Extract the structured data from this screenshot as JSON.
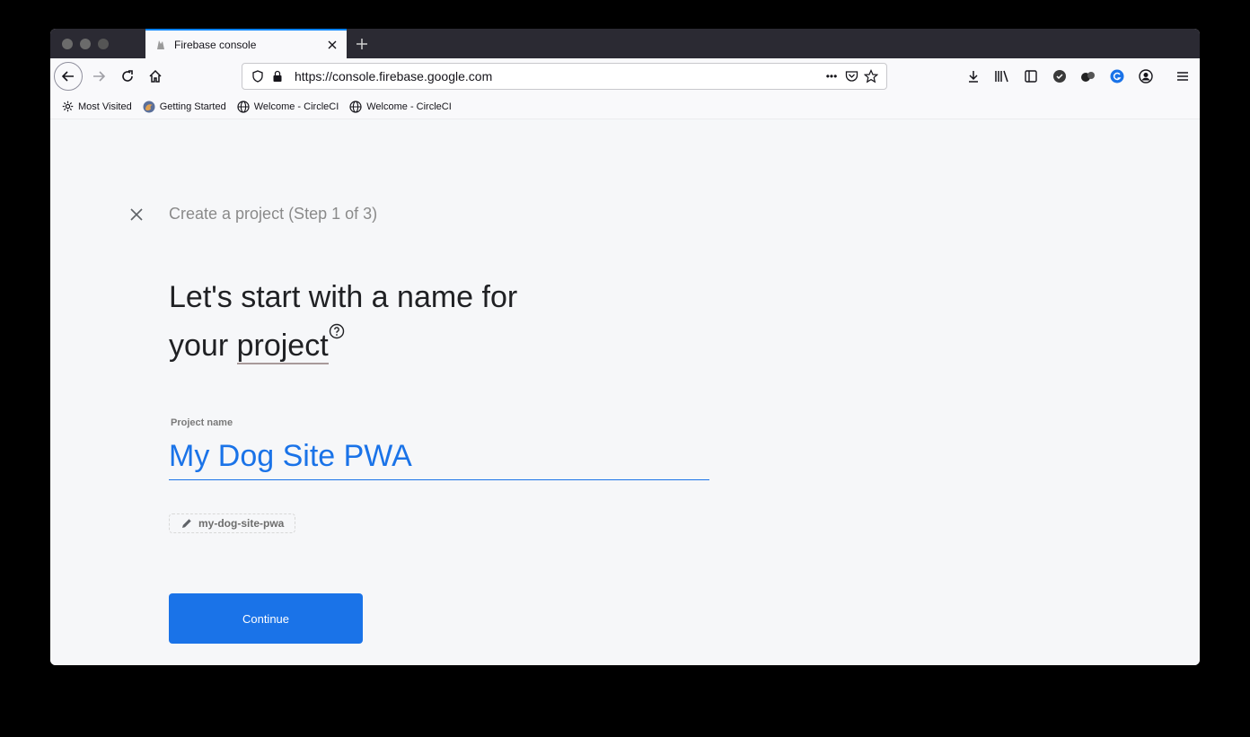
{
  "browser": {
    "tab_title": "Firebase console",
    "url": "https://console.firebase.google.com",
    "url_overflow": "•••"
  },
  "bookmarks": [
    {
      "label": "Most Visited",
      "icon": "gear-icon"
    },
    {
      "label": "Getting Started",
      "icon": "firefox-icon"
    },
    {
      "label": "Welcome - CircleCI",
      "icon": "globe-icon"
    },
    {
      "label": "Welcome - CircleCI",
      "icon": "globe-icon"
    }
  ],
  "page": {
    "step_title": "Create a project (Step 1 of 3)",
    "headline_line1": "Let's start with a name for",
    "headline_line2_prefix": "your ",
    "headline_link": "project",
    "field_label": "Project name",
    "field_value": "My Dog Site PWA",
    "project_id": "my-dog-site-pwa",
    "continue_label": "Continue"
  },
  "colors": {
    "accent": "#1a73e8",
    "background": "#f6f7f9"
  }
}
